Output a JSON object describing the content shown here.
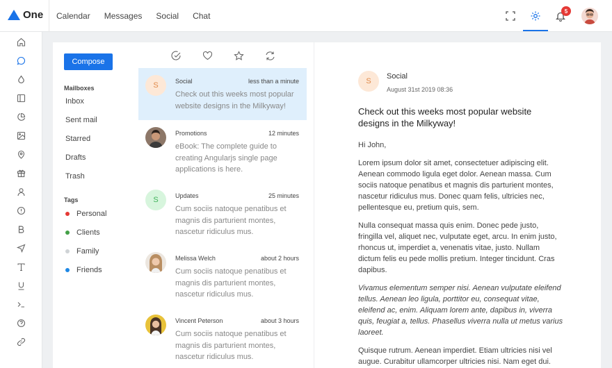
{
  "app": {
    "name": "One"
  },
  "topnav": [
    "Calendar",
    "Messages",
    "Social",
    "Chat"
  ],
  "notifications": {
    "count": "5"
  },
  "compose_label": "Compose",
  "mailboxes": {
    "title": "Mailboxes",
    "items": [
      "Inbox",
      "Sent mail",
      "Starred",
      "Drafts",
      "Trash"
    ]
  },
  "tags": {
    "title": "Tags",
    "items": [
      {
        "label": "Personal",
        "color": "#e53935"
      },
      {
        "label": "Clients",
        "color": "#43a047"
      },
      {
        "label": "Family",
        "color": "#cfd3d6"
      },
      {
        "label": "Friends",
        "color": "#1e88e5"
      }
    ]
  },
  "messages": [
    {
      "from": "Social",
      "time": "less than a minute",
      "snippet": "Check out this weeks most popular website designs in the Milkyway!",
      "initial": "S",
      "avatar_bg": "#fde8d7",
      "avatar_fg": "#e08a4a"
    },
    {
      "from": "Promotions",
      "time": "12 minutes",
      "snippet": "eBook: The complete guide to creating Angularjs single page applications is here.",
      "initial": "",
      "avatar_bg": "#5b4a42",
      "avatar_fg": "#fff"
    },
    {
      "from": "Updates",
      "time": "25 minutes",
      "snippet": "Cum sociis natoque penatibus et magnis dis parturient montes, nascetur ridiculus mus.",
      "initial": "S",
      "avatar_bg": "#d7f5dd",
      "avatar_fg": "#3fb25a"
    },
    {
      "from": "Melissa Welch",
      "time": "about 2 hours",
      "snippet": "Cum sociis natoque penatibus et magnis dis parturient montes, nascetur ridiculus mus.",
      "initial": "",
      "avatar_bg": "#d9b89a",
      "avatar_fg": "#fff"
    },
    {
      "from": "Vincent Peterson",
      "time": "about 3 hours",
      "snippet": "Cum sociis natoque penatibus et magnis dis parturient montes, nascetur ridiculus mus.",
      "initial": "",
      "avatar_bg": "#e8c23a",
      "avatar_fg": "#fff"
    }
  ],
  "reader": {
    "initial": "S",
    "from": "Social",
    "date": "August 31st 2019 08:36",
    "subject": "Check out this weeks most popular website designs in the Milkyway!",
    "greeting": "Hi John,",
    "p1": "Lorem ipsum dolor sit amet, consectetuer adipiscing elit. Aenean commodo ligula eget dolor. Aenean massa. Cum sociis natoque penatibus et magnis dis parturient montes, nascetur ridiculus mus. Donec quam felis, ultricies nec, pellentesque eu, pretium quis, sem.",
    "p2": "Nulla consequat massa quis enim. Donec pede justo, fringilla vel, aliquet nec, vulputate eget, arcu. In enim justo, rhoncus ut, imperdiet a, venenatis vitae, justo. Nullam dictum felis eu pede mollis pretium. Integer tincidunt. Cras dapibus.",
    "p3": "Vivamus elementum semper nisi. Aenean vulputate eleifend tellus. Aenean leo ligula, porttitor eu, consequat vitae, eleifend ac, enim. Aliquam lorem ante, dapibus in, viverra quis, feugiat a, tellus. Phasellus viverra nulla ut metus varius laoreet.",
    "p4": "Quisque rutrum. Aenean imperdiet. Etiam ultricies nisi vel augue. Curabitur ullamcorper ultricies nisi. Nam eget dui."
  },
  "colors": {
    "accent": "#1a73e8",
    "selected_row": "#dfeffc",
    "badge": "#e53935"
  },
  "sidebar_icons": [
    "home-icon",
    "chat-icon",
    "droplet-icon",
    "layout-icon",
    "pie-chart-icon",
    "image-icon",
    "map-pin-icon",
    "gift-icon",
    "user-icon",
    "alert-icon",
    "bold-icon",
    "send-icon",
    "type-icon",
    "underline-icon",
    "terminal-icon",
    "help-icon",
    "link-icon"
  ]
}
